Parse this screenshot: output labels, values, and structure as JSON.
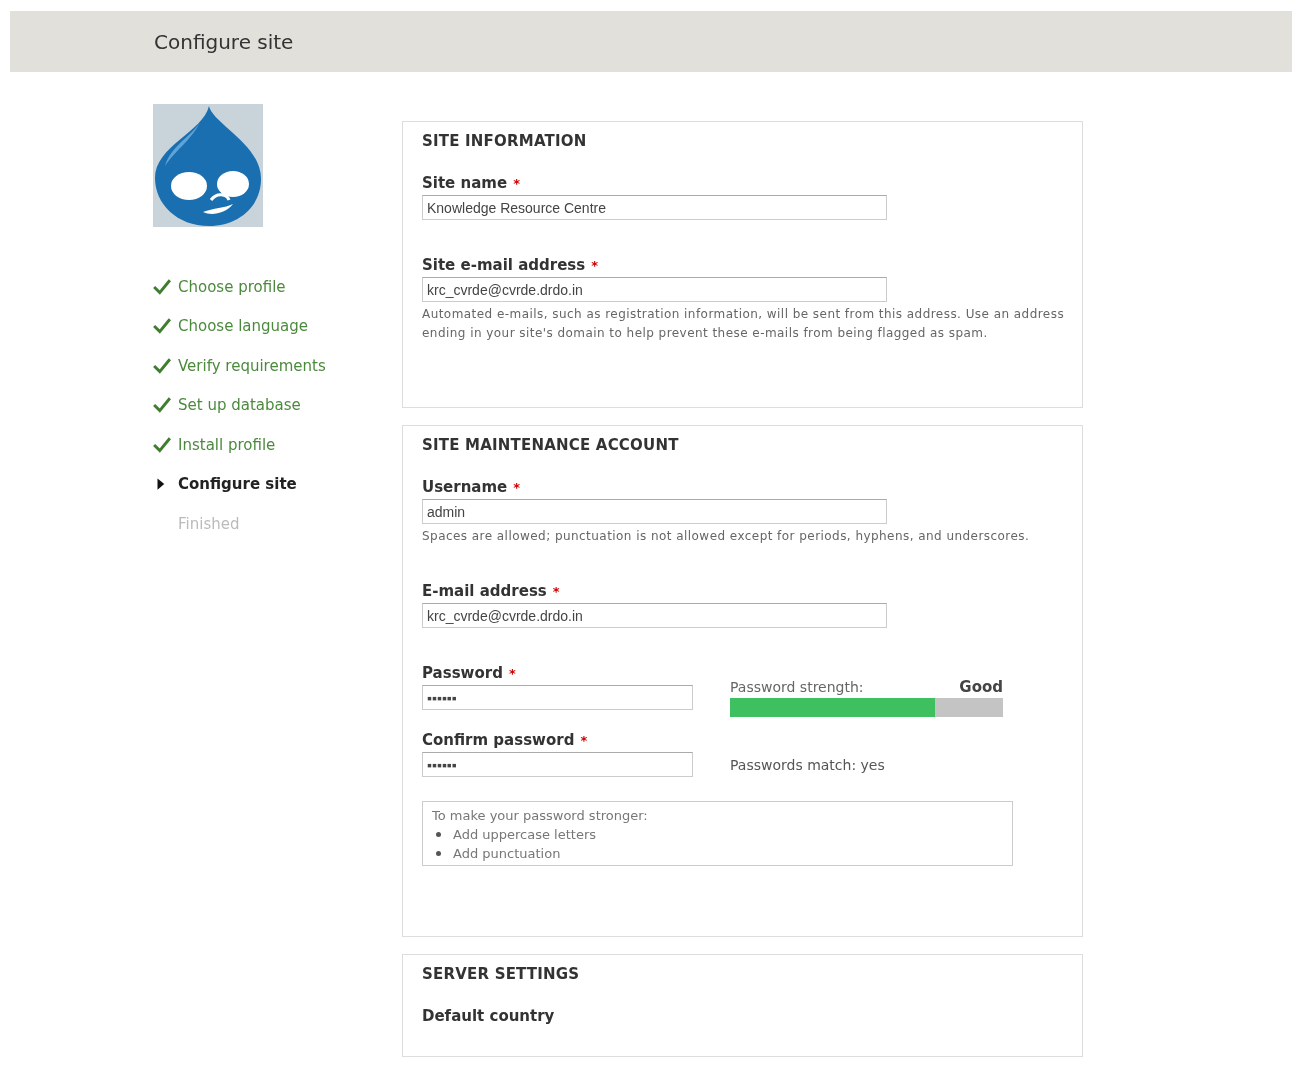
{
  "header": {
    "title": "Configure site"
  },
  "steps": [
    {
      "label": "Choose profile",
      "kind": "done"
    },
    {
      "label": "Choose language",
      "kind": "done"
    },
    {
      "label": "Verify requirements",
      "kind": "done"
    },
    {
      "label": "Set up database",
      "kind": "done"
    },
    {
      "label": "Install profile",
      "kind": "done"
    },
    {
      "label": "Configure site",
      "kind": "current"
    },
    {
      "label": "Finished",
      "kind": "pending"
    }
  ],
  "sections": [
    {
      "title": "SITE INFORMATION",
      "fields": [
        {
          "kind": "text",
          "label": "Site name",
          "required_mark": "*",
          "value": "Knowledge Resource Centre"
        },
        {
          "kind": "text",
          "label": "Site e-mail address",
          "required_mark": "*",
          "value": "krc_cvrde@cvrde.drdo.in",
          "description": "Automated e-mails, such as registration information, will be sent from this address. Use an address ending in your site's domain to help prevent these e-mails from being flagged as spam."
        }
      ]
    },
    {
      "title": "SITE MAINTENANCE ACCOUNT",
      "fields": [
        {
          "kind": "text",
          "label": "Username",
          "required_mark": "*",
          "value": "admin",
          "description": "Spaces are allowed; punctuation is not allowed except for periods, hyphens, and underscores."
        },
        {
          "kind": "text",
          "label": "E-mail address",
          "required_mark": "*",
          "value": "krc_cvrde@cvrde.drdo.in"
        },
        {
          "kind": "password",
          "label": "Password",
          "required_mark": "*",
          "value": "▪▪▪▪▪▪",
          "strength": {
            "label": "Password strength:",
            "rating": "Good",
            "level": 0.75
          }
        },
        {
          "kind": "confirm",
          "label": "Confirm password",
          "required_mark": "*",
          "value": "▪▪▪▪▪▪",
          "match": "Passwords match: yes"
        },
        {
          "kind": "suggestions",
          "intro": "To make your password stronger:",
          "items": [
            "Add uppercase letters",
            "Add punctuation"
          ]
        }
      ]
    },
    {
      "title": "SERVER SETTINGS",
      "fields": [
        {
          "kind": "heading",
          "label": "Default country"
        }
      ]
    }
  ]
}
